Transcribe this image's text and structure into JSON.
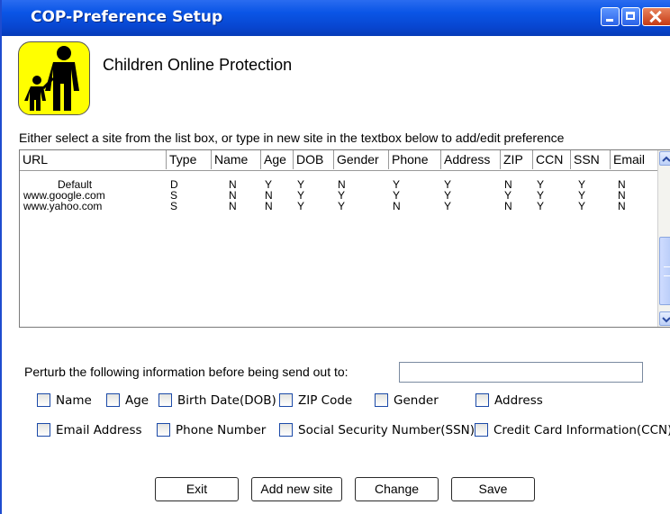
{
  "window": {
    "title": "COP-Preference Setup",
    "minimize_icon": "minimize-icon",
    "maximize_icon": "maximize-icon",
    "close_icon": "close-icon",
    "accent_color": "#0a55e6"
  },
  "app": {
    "logo_icon": "parent-child-icon",
    "logo_color": "#ffff00",
    "title": "Children Online Protection"
  },
  "instruction": "Either select a site from the list box, or type in new site in the textbox below to add/edit preference",
  "table": {
    "columns": [
      "URL",
      "Type",
      "Name",
      "Age",
      "DOB",
      "Gender",
      "Phone",
      "Address",
      "ZIP",
      "CCN",
      "SSN",
      "Email"
    ],
    "rows": [
      [
        "Default",
        "D",
        "N",
        "Y",
        "Y",
        "N",
        "Y",
        "Y",
        "N",
        "Y",
        "Y",
        "N"
      ],
      [
        "www.google.com",
        "S",
        "N",
        "N",
        "Y",
        "Y",
        "Y",
        "Y",
        "Y",
        "Y",
        "Y",
        "N"
      ],
      [
        "www.yahoo.com",
        "S",
        "N",
        "N",
        "Y",
        "Y",
        "N",
        "Y",
        "N",
        "Y",
        "Y",
        "N"
      ]
    ]
  },
  "perturb": {
    "label": "Perturb the following information before being send out to:",
    "site_value": "",
    "checkboxes_row1": [
      "Name",
      "Age",
      "Birth Date(DOB)",
      "ZIP Code",
      "Gender",
      "Address"
    ],
    "checkboxes_row2": [
      "Email Address",
      "Phone Number",
      "Social Security Number(SSN)",
      "Credit Card Information(CCN)"
    ]
  },
  "buttons": {
    "exit": "Exit",
    "add_new_site": "Add new site",
    "change": "Change",
    "save": "Save"
  }
}
